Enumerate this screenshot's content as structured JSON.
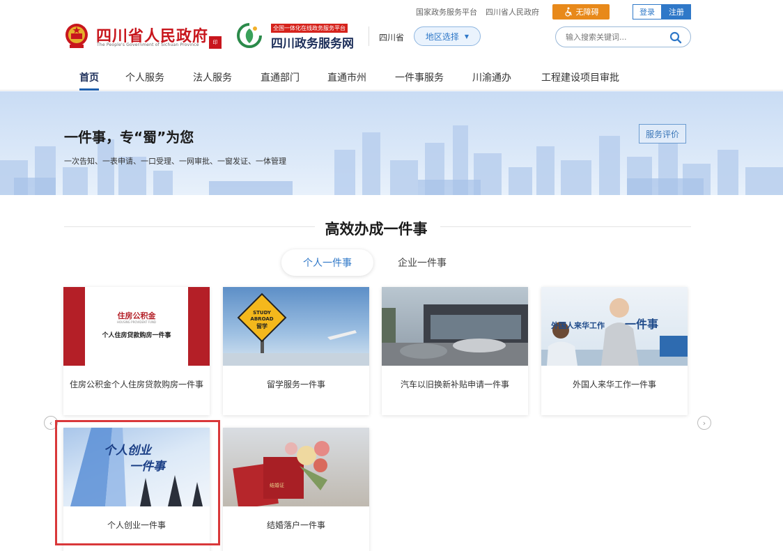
{
  "util": {
    "links": [
      "国家政务服务平台",
      "四川省人民政府"
    ],
    "accessibility": "无障碍",
    "login": "登录",
    "register": "注册"
  },
  "header": {
    "gov_name": "四川省人民政府",
    "gov_en": "The People's Government of Sichuan Province",
    "svc_tag": "全国一体化在线政务服务平台",
    "svc_name": "四川政务服务网",
    "province": "四川省",
    "region_btn": "地区选择",
    "search_placeholder": "输入搜索关键词..."
  },
  "nav": [
    "首页",
    "个人服务",
    "法人服务",
    "直通部门",
    "直通市州",
    "一件事服务",
    "川渝通办",
    "工程建设项目审批"
  ],
  "banner": {
    "title": "一件事，专“蜀”为您",
    "subtitle": "一次告知、一表申请、一口受理、一网审批、一窗发证、一体管理",
    "rate_btn": "服务评价"
  },
  "section": {
    "title": "高效办成一件事"
  },
  "tabs": [
    "个人一件事",
    "企业一件事"
  ],
  "cards": [
    {
      "label": "住房公积金个人住房贷款购房一件事",
      "img_brand": "住房公积金",
      "img_brand_en": "HOUSING PROVIDENT FUND",
      "img_caption": "个人住房贷款购房一件事"
    },
    {
      "label": "留学服务一件事",
      "img_sign_en": "STUDY ABROAD",
      "img_sign_cn": "留学"
    },
    {
      "label": "汽车以旧换新补贴申请一件事"
    },
    {
      "label": "外国人来华工作一件事",
      "img_caption": "外国人来华工作",
      "img_caption2": "一件事"
    },
    {
      "label": "个人创业一件事",
      "img_caption": "个人创业",
      "img_caption2": "一件事"
    },
    {
      "label": "结婚落户一件事",
      "img_cert": "结婚证"
    }
  ],
  "colors": {
    "accent": "#2f78c8",
    "brand_red": "#c8161d",
    "highlight": "#d9383a",
    "orange": "#e8891a"
  }
}
